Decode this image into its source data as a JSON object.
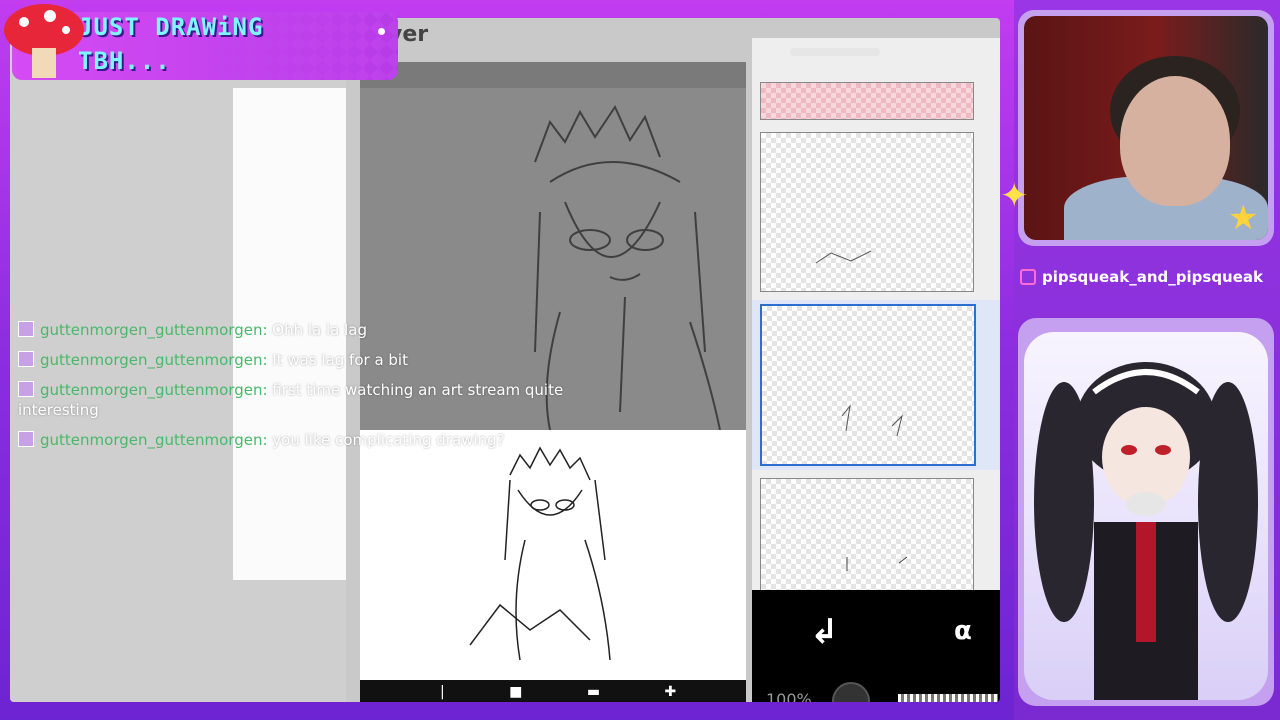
{
  "stream": {
    "title_lines": [
      "JUST DRAWiNG",
      "TBH..."
    ],
    "social_handle": "pipsqueak_and_pipsqueak"
  },
  "app": {
    "panel_title_fragment": "yer",
    "opacity_percent": "100%",
    "toolbar_icons": [
      "arrow-down-left-icon",
      "lock-alpha-icon"
    ],
    "alpha_symbol": "α",
    "arrow_symbol": "↲"
  },
  "layers": {
    "selected_index": 2,
    "items": [
      {
        "name": "layer-pink"
      },
      {
        "name": "layer-1"
      },
      {
        "name": "layer-2"
      },
      {
        "name": "layer-3"
      }
    ]
  },
  "chat": {
    "messages": [
      {
        "user": "guttenmorgen_guttenmorgen",
        "text": "Ohh la la lag"
      },
      {
        "user": "guttenmorgen_guttenmorgen",
        "text": "It was lag for a bit"
      },
      {
        "user": "guttenmorgen_guttenmorgen",
        "text": "first time watching an art stream quite interesting"
      },
      {
        "user": "guttenmorgen_guttenmorgen",
        "text": "you like complicating drawing?"
      }
    ]
  },
  "colors": {
    "frame": "#8b2de0",
    "accent": "#7ef6ff",
    "chat_user": "#4ab86a",
    "selection": "#2c6fd0"
  }
}
